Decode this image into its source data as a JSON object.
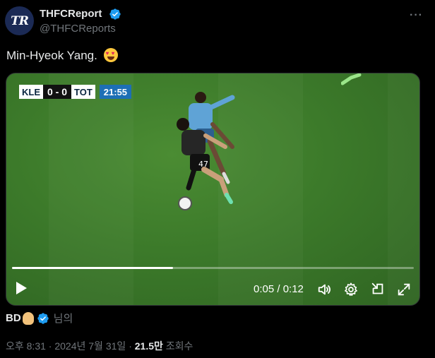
{
  "author": {
    "avatar_text": "TR",
    "name": "THFCReport",
    "handle": "@THFCReports",
    "verified_color": "#1d9bf0"
  },
  "more_menu_label": "···",
  "tweet": {
    "text": "Min-Hyeok Yang.",
    "emoji": "heart-eyes"
  },
  "video": {
    "scorebar": {
      "home": "KLE",
      "score": "0 - 0",
      "away": "TOT",
      "clock": "21:55"
    },
    "progress": 0.4,
    "time_display": "0:05 / 0:12",
    "controls": [
      "play-icon",
      "volume-icon",
      "settings-icon",
      "picture-in-picture-icon",
      "fullscreen-icon"
    ]
  },
  "byline": {
    "name": "BD",
    "suffix": "님의"
  },
  "meta": {
    "time": "오후 8:31",
    "separator": "·",
    "date": "2024년 7월 31일",
    "views_count": "21.5만",
    "views_label": "조회수"
  }
}
